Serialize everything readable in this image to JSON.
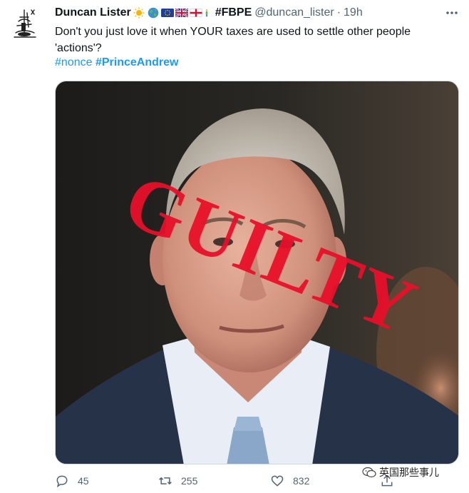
{
  "tweet": {
    "author_name": "Duncan Lister",
    "emoji_icons": [
      "sun-icon",
      "earth-icon",
      "eu-flag-icon",
      "uk-flag-icon",
      "england-flag-icon",
      "person-icon"
    ],
    "tag": "#FBPE",
    "handle": "@duncan_lister",
    "dot": "·",
    "time": "19h",
    "text": "Don't you just love it when YOUR taxes are used to settle other people 'actions'?",
    "hashtags": [
      "#nonce",
      "#PrinceAndrew"
    ],
    "image_overlay_text": "GUILTY",
    "replies": "45",
    "retweets": "255",
    "likes": "832"
  },
  "watermark": "英国那些事儿",
  "colors": {
    "accent": "#1d9bf0",
    "muted": "#536471",
    "overlay_red": "#e8102a"
  }
}
